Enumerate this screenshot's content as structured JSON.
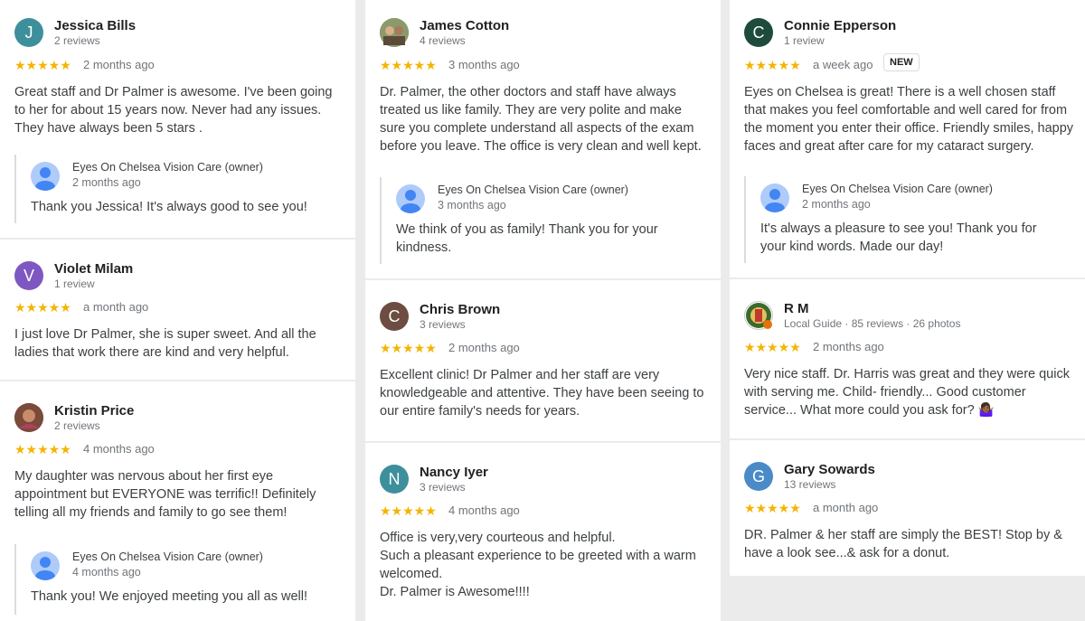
{
  "stars": "★★★★★",
  "owner_name": "Eyes On Chelsea Vision Care (owner)",
  "colors": {
    "star": "#f4b400",
    "avatar_teal": "#3d8f9b",
    "avatar_purple": "#7e57c2",
    "avatar_green": "#1e4b3b",
    "avatar_brown": "#6d4c41",
    "avatar_blue": "#4a8bc7"
  },
  "reviews": [
    {
      "initial": "J",
      "name": "Jessica Bills",
      "sub": "2 reviews",
      "time": "2 months ago",
      "text": "Great staff and Dr Palmer is awesome. I've been going to her for about 15 years now. Never had any issues. They have always been 5 stars .",
      "reply": {
        "time": "2 months ago",
        "text": "Thank you Jessica! It's always good to see you!"
      }
    },
    {
      "initial": "V",
      "name": "Violet Milam",
      "sub": "1 review",
      "time": "a month ago",
      "text": "I just love Dr Palmer, she is super sweet. And all the ladies that work there are kind and very helpful."
    },
    {
      "initial": "",
      "name": "Kristin Price",
      "sub": "2 reviews",
      "time": "4 months ago",
      "text": "My daughter was nervous about her first eye appointment but EVERYONE was terrific!! Definitely telling all my friends and family to go see them!",
      "reply": {
        "time": "4 months ago",
        "text": "Thank you! We enjoyed meeting you all as well!"
      }
    },
    {
      "initial": "",
      "name": "James Cotton",
      "sub": "4 reviews",
      "time": "3 months ago",
      "text": "Dr. Palmer, the other doctors and staff have always treated us like family. They are very polite and make sure you complete understand all aspects of the exam before you leave. The office is very clean and well kept.",
      "reply": {
        "time": "3 months ago",
        "text": "We think of you as family! Thank you for your kindness."
      }
    },
    {
      "initial": "C",
      "name": "Chris Brown",
      "sub": "3 reviews",
      "time": "2 months ago",
      "text": "Excellent clinic! Dr Palmer and her staff are very knowledgeable and attentive. They have been seeing to our entire family's needs for years."
    },
    {
      "initial": "N",
      "name": "Nancy Iyer",
      "sub": "3 reviews",
      "time": "4 months ago",
      "text": "Office is very,very courteous and helpful.\nSuch a pleasant experience to be greeted with a warm welcomed.\nDr. Palmer is Awesome!!!!"
    },
    {
      "initial": "C",
      "name": "Connie Epperson",
      "sub": "1 review",
      "time": "a week ago",
      "badge": "NEW",
      "text": "Eyes on Chelsea is great! There is a well chosen staff that makes you feel comfortable and well cared for from the moment you enter their office. Friendly smiles, happy faces and great after care for my cataract surgery.",
      "reply": {
        "time": "2 months ago",
        "text": "It's always a pleasure to see you! Thank you for your kind words. Made our day!"
      }
    },
    {
      "initial": "",
      "name": "R M",
      "sub": "Local Guide · 85 reviews · 26 photos",
      "time": "2 months ago",
      "text": "Very nice staff. Dr. Harris was great and they were quick with serving me. Child- friendly... Good customer service... What more could you ask for? 🤷🏾‍♀️"
    },
    {
      "initial": "G",
      "name": "Gary Sowards",
      "sub": "13 reviews",
      "time": "a month ago",
      "text": "DR. Palmer & her staff are simply the BEST! Stop by & have a look see...& ask for a donut."
    }
  ]
}
